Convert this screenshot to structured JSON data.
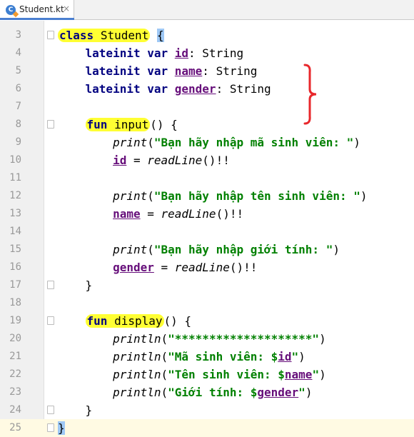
{
  "tab": {
    "title": "Student.kt",
    "close": "×",
    "icon": "kotlin-file-icon"
  },
  "lines": [
    {
      "num": "3"
    },
    {
      "num": "4"
    },
    {
      "num": "5"
    },
    {
      "num": "6"
    },
    {
      "num": "7"
    },
    {
      "num": "8"
    },
    {
      "num": "9"
    },
    {
      "num": "10"
    },
    {
      "num": "11"
    },
    {
      "num": "12"
    },
    {
      "num": "13"
    },
    {
      "num": "14"
    },
    {
      "num": "15"
    },
    {
      "num": "16"
    },
    {
      "num": "17"
    },
    {
      "num": "18"
    },
    {
      "num": "19"
    },
    {
      "num": "20"
    },
    {
      "num": "21"
    },
    {
      "num": "22"
    },
    {
      "num": "23"
    },
    {
      "num": "24"
    },
    {
      "num": "25"
    }
  ],
  "code": {
    "class_kw": "class",
    "class_name": "Student",
    "open_brace": "{",
    "lateinit_var": "lateinit var",
    "id": "id",
    "name": "name",
    "gender": "gender",
    "type_string": ": String",
    "fun_kw": "fun",
    "input_name": "input",
    "display_name": "display",
    "parens_brace": "() {",
    "print": "print",
    "println": "println",
    "readLine": "readLine",
    "str_ma": "\"Bạn hãy nhập mã sinh viên: \"",
    "str_ten": "\"Bạn hãy nhập tên sinh viên: \"",
    "str_gt": "\"Bạn hãy nhập giới tính: \"",
    "str_stars": "\"********************\"",
    "str_ma_pre": "\"Mã sinh viên: $",
    "str_ten_pre": "\"Tên sinh viên: $",
    "str_gt_pre": "\"Giới tính: $",
    "str_end": "\"",
    "assign": " = ",
    "call_bang": "()!!",
    "close_brace": "}"
  },
  "annotation_color": "#e8272b"
}
